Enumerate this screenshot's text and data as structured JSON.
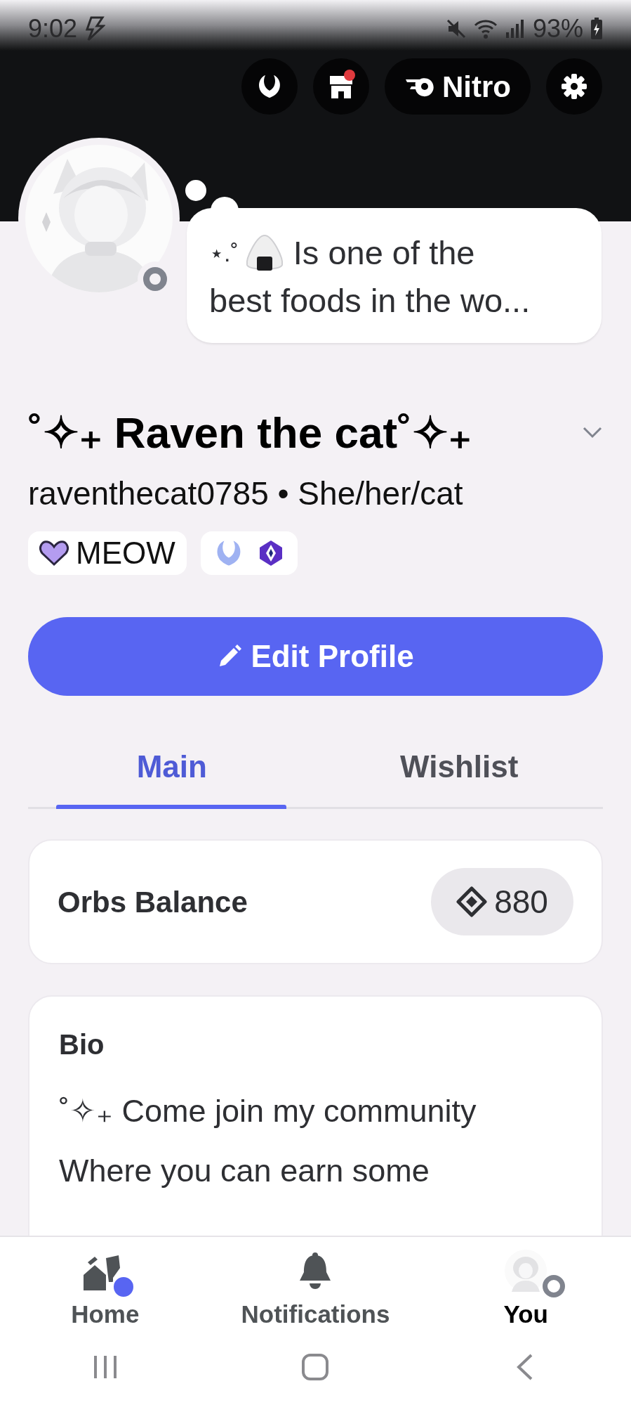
{
  "status_bar": {
    "time": "9:02",
    "battery": "93%"
  },
  "header": {
    "buttons": [
      {
        "kind": "quests"
      },
      {
        "kind": "shop",
        "badge": true
      },
      {
        "kind": "nitro",
        "label": "Nitro"
      },
      {
        "kind": "settings"
      }
    ]
  },
  "profile": {
    "status_prefix": "⋆.˚",
    "status_lines": [
      "Is one of the",
      "best foods in the wo..."
    ],
    "display_name": "˚✧₊ Raven the cat˚✧₊",
    "handle_line": "raventhecat0785 • She/her/cat",
    "tag": {
      "label": "MEOW"
    }
  },
  "edit_button": {
    "label": "Edit Profile"
  },
  "tabs": [
    {
      "label": "Main",
      "selected": true
    },
    {
      "label": "Wishlist",
      "selected": false
    }
  ],
  "orbs": {
    "title": "Orbs Balance",
    "amount": "880"
  },
  "bio": {
    "title": "Bio",
    "text": "˚✧₊ Come join my community\nWhere you can earn some"
  },
  "nav": [
    {
      "kind": "home",
      "label": "Home",
      "selected": false,
      "unread": true
    },
    {
      "kind": "bell",
      "label": "Notifications",
      "selected": false,
      "unread": false
    },
    {
      "label": "You",
      "selected": true,
      "unread": false
    }
  ]
}
